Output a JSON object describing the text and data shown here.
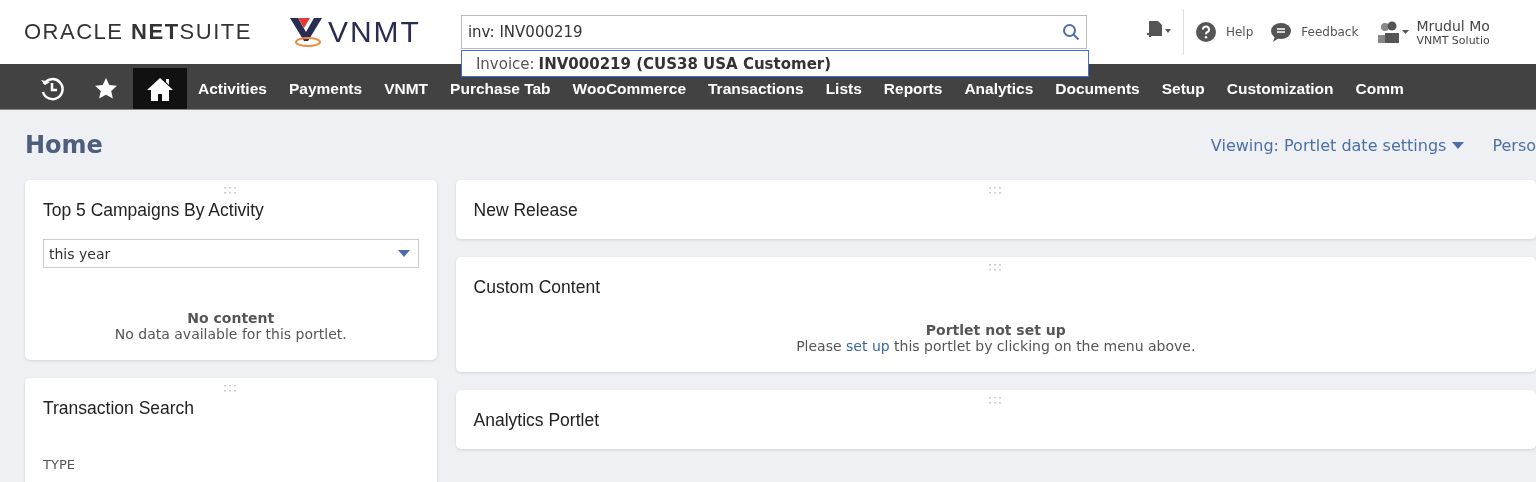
{
  "header": {
    "oracle_logo": {
      "part_1": "ORACLE ",
      "part_2": "NET",
      "part_3": "SUITE"
    },
    "company_logo": "VNMT",
    "search": {
      "value": "inv: INV000219"
    },
    "suggestion": {
      "label": "Invoice: ",
      "value": "INV000219 (CUS38 USA Customer)"
    },
    "help": "Help",
    "feedback": "Feedback",
    "user": {
      "name": "Mrudul Mo",
      "company": "VNMT Solutio"
    }
  },
  "nav": {
    "items": [
      {
        "label": "Activities",
        "selected": false
      },
      {
        "label": "Payments",
        "selected": false
      },
      {
        "label": "VNMT",
        "selected": false
      },
      {
        "label": "Purchase Tab",
        "selected": false
      },
      {
        "label": "WooCommerce",
        "selected": false
      },
      {
        "label": "Transactions",
        "selected": false
      },
      {
        "label": "Lists",
        "selected": false
      },
      {
        "label": "Reports",
        "selected": false
      },
      {
        "label": "Analytics",
        "selected": false
      },
      {
        "label": "Documents",
        "selected": false
      },
      {
        "label": "Setup",
        "selected": false
      },
      {
        "label": "Customization",
        "selected": false
      },
      {
        "label": "Comm",
        "selected": false
      }
    ],
    "home_selected": true
  },
  "page": {
    "title": "Home",
    "viewing": "Viewing: Portlet date settings",
    "personalize": "Perso"
  },
  "left_portlets": [
    {
      "title": "Top 5 Campaigns By Activity",
      "kind": "select",
      "select_value": "this year",
      "empty_title": "No content",
      "empty_text": "No data available for this portlet."
    },
    {
      "title": "Transaction Search",
      "kind": "form",
      "field_label": "TYPE"
    }
  ],
  "right_portlets": [
    {
      "title": "New Release",
      "kind": "plain"
    },
    {
      "title": "Custom Content",
      "kind": "notice",
      "empty_title": "Portlet not set up",
      "text_before": "Please ",
      "link": "set up",
      "text_after": " this portlet by clicking on the menu above."
    },
    {
      "title": "Analytics Portlet",
      "kind": "plain"
    }
  ]
}
